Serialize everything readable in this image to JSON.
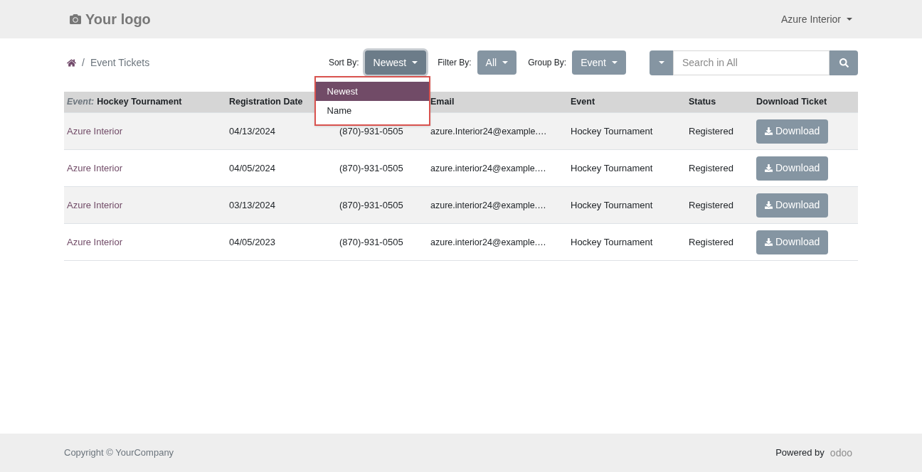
{
  "header": {
    "logo": "Your logo",
    "user": "Azure Interior"
  },
  "breadcrumb": {
    "separator": "/",
    "items": [
      "Event Tickets"
    ]
  },
  "controls": {
    "sort_label": "Sort By:",
    "sort_value": "Newest",
    "filter_label": "Filter By:",
    "filter_value": "All",
    "group_label": "Group By:",
    "group_value": "Event",
    "search_placeholder": "Search in All"
  },
  "sort_menu": [
    {
      "label": "Newest",
      "selected": true
    },
    {
      "label": "Name",
      "selected": false
    }
  ],
  "table": {
    "columns": [
      {
        "kind": "group",
        "prefix": "Event:",
        "label": "Hockey Tournament"
      },
      {
        "kind": "plain",
        "label": "Registration Date"
      },
      {
        "kind": "hidden"
      },
      {
        "kind": "plain",
        "label": "Email"
      },
      {
        "kind": "plain",
        "label": "Event"
      },
      {
        "kind": "plain",
        "label": "Status"
      },
      {
        "kind": "plain",
        "label": "Download Ticket"
      }
    ],
    "rows": [
      {
        "name": "Azure Interior",
        "date": "04/13/2024",
        "phone": "(870)-931-0505",
        "email": "azure.Interior24@example.…",
        "event": "Hockey Tournament",
        "status": "Registered",
        "action": "Download"
      },
      {
        "name": "Azure Interior",
        "date": "04/05/2024",
        "phone": "(870)-931-0505",
        "email": "azure.interior24@example.…",
        "event": "Hockey Tournament",
        "status": "Registered",
        "action": "Download"
      },
      {
        "name": "Azure Interior",
        "date": "03/13/2024",
        "phone": "(870)-931-0505",
        "email": "azure.interior24@example.…",
        "event": "Hockey Tournament",
        "status": "Registered",
        "action": "Download"
      },
      {
        "name": "Azure Interior",
        "date": "04/05/2023",
        "phone": "(870)-931-0505",
        "email": "azure.interior24@example.…",
        "event": "Hockey Tournament",
        "status": "Registered",
        "action": "Download"
      }
    ]
  },
  "footer": {
    "copyright": "Copyright © YourCompany",
    "powered": "Powered by",
    "brand": "odoo"
  }
}
